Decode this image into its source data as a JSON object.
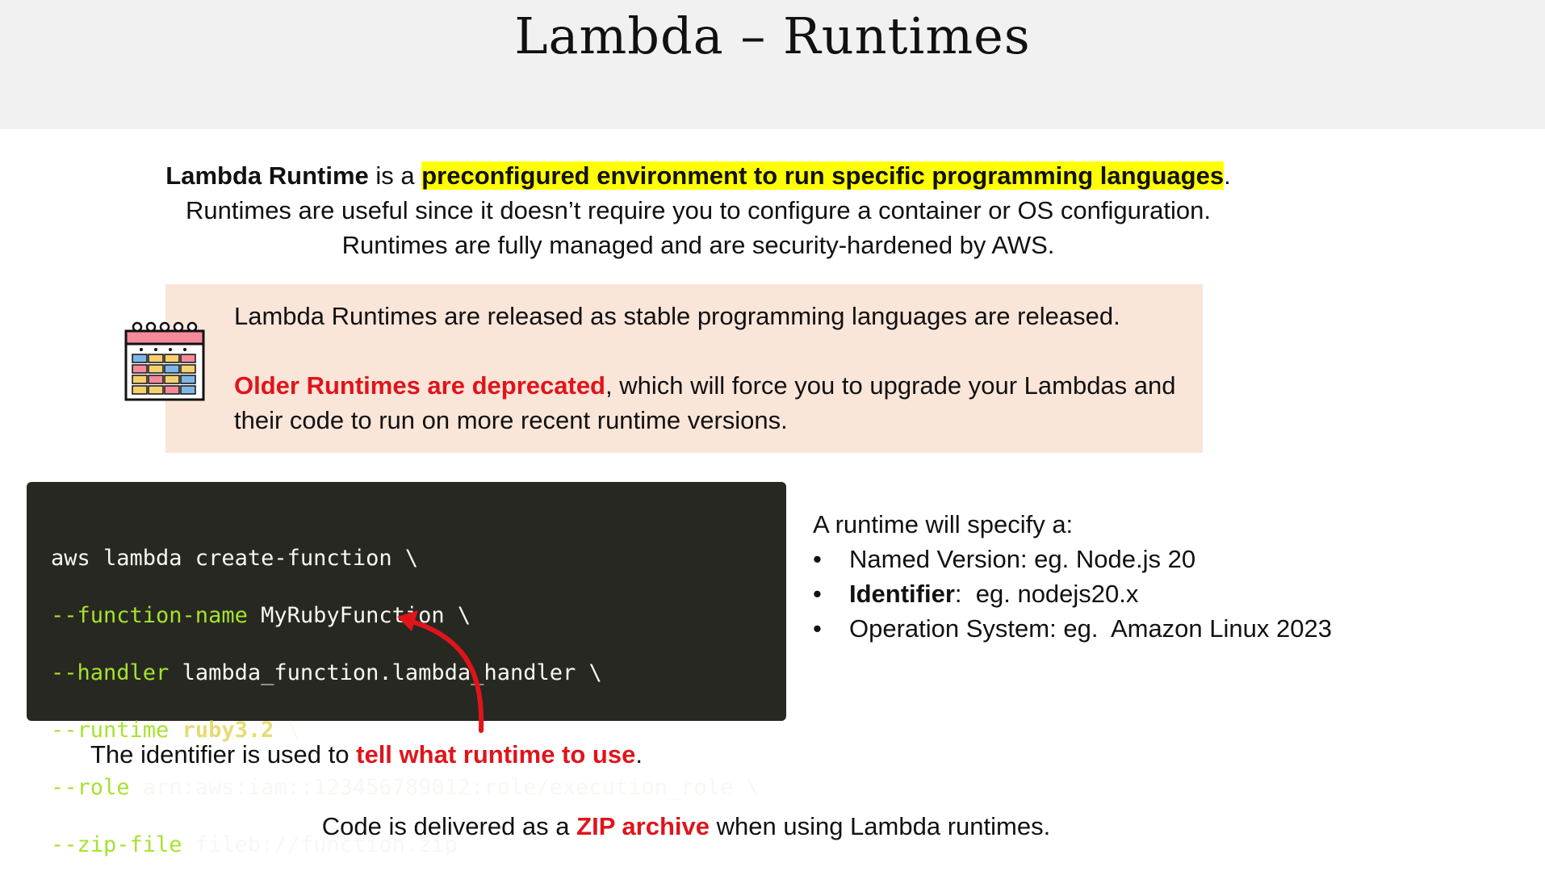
{
  "slide": {
    "title": "Lambda – Runtimes"
  },
  "intro": {
    "term": "Lambda Runtime",
    "is_a": " is a ",
    "definition": "preconfigured environment to run specific programming languages",
    "period": ".",
    "line2": "Runtimes are useful since it doesn’t require you to configure a container or OS configuration.",
    "line3": "Runtimes are fully managed and are security-hardened by AWS."
  },
  "callout": {
    "icon": "calendar-icon",
    "line1": "Lambda Runtimes are released as stable programming languages are released.",
    "deprecated": "Older Runtimes are deprecated",
    "rest": ", which will force you to upgrade your Lambdas and their code to run on more recent runtime versions."
  },
  "code": {
    "lines": [
      {
        "flag": "",
        "value": "aws lambda create-function \\"
      },
      {
        "flag": "--function-name",
        "value": " MyRubyFunction \\"
      },
      {
        "flag": "--handler",
        "value": " lambda_function.lambda_handler \\"
      },
      {
        "flag": "--runtime",
        "value_hi": " ruby3.2",
        "value": " \\"
      },
      {
        "flag": "--role",
        "value": " arn:aws:iam::123456789012:role/execution_role \\"
      },
      {
        "flag": "--zip-file",
        "value": " fileb://function.zip"
      }
    ]
  },
  "caption": {
    "before": "The identifier is used to ",
    "highlight": "tell what runtime to use",
    "after": "."
  },
  "spec": {
    "heading": "A runtime will specify a:",
    "bullet": "•",
    "items": [
      {
        "label": "Named Version:",
        "text": " eg. Node.js 20"
      },
      {
        "label": "Identifier",
        "text": ":  eg. nodejs20.x"
      },
      {
        "label": "Operation System:",
        "text": " eg.  Amazon Linux 2023"
      }
    ]
  },
  "footer": {
    "before": "Code is delivered as a ",
    "highlight": "ZIP archive",
    "after": " when using Lambda runtimes."
  },
  "colors": {
    "accent_red": "#e0141b",
    "highlight_yellow": "#ffff00",
    "callout_bg": "#fae5d9",
    "code_bg": "#272822",
    "code_flag": "#a6e22e",
    "code_value_highlight": "#e6db74"
  }
}
